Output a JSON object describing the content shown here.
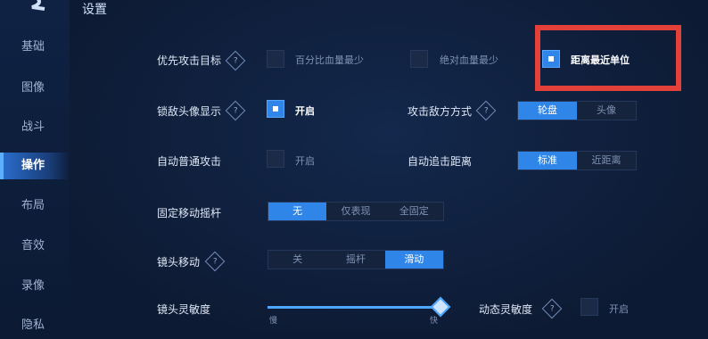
{
  "header": {
    "title": "设置"
  },
  "sidebar": {
    "items": [
      {
        "label": "基础"
      },
      {
        "label": "图像"
      },
      {
        "label": "战斗"
      },
      {
        "label": "操作",
        "active": true
      },
      {
        "label": "布局"
      },
      {
        "label": "音效"
      },
      {
        "label": "录像"
      },
      {
        "label": "隐私"
      }
    ]
  },
  "settings": {
    "target_priority": {
      "label": "优先攻击目标",
      "options": [
        "百分比血量最少",
        "绝对血量最少",
        "距离最近单位"
      ],
      "selected": "距离最近单位"
    },
    "lock_portrait": {
      "label": "锁敌头像显示",
      "option": "开启",
      "checked": true
    },
    "attack_mode": {
      "label": "攻击敌方方式",
      "options": [
        "轮盘",
        "头像"
      ],
      "selected": "轮盘"
    },
    "auto_attack": {
      "label": "自动普通攻击",
      "option": "开启",
      "checked": false
    },
    "auto_chase": {
      "label": "自动追击距离",
      "options": [
        "标准",
        "近距离"
      ],
      "selected": "标准"
    },
    "fixed_joystick": {
      "label": "固定移动摇杆",
      "options": [
        "无",
        "仅表现",
        "全固定"
      ],
      "selected": "无"
    },
    "camera_move": {
      "label": "镜头移动",
      "options": [
        "关",
        "摇杆",
        "滑动"
      ],
      "selected": "滑动"
    },
    "camera_sensitivity": {
      "label": "镜头灵敏度",
      "min_label": "慢",
      "max_label": "快",
      "value": 1.0
    },
    "dynamic_sensitivity": {
      "label": "动态灵敏度",
      "option": "开启",
      "checked": false
    }
  },
  "help_icon": "?",
  "colors": {
    "accent": "#2f86e8",
    "highlight": "#e3403a",
    "background": "#0d1a33"
  }
}
